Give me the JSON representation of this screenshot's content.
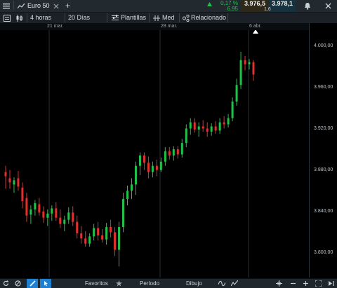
{
  "header": {
    "instrument": "Euro 50",
    "change_pct": "0,17 %",
    "change_abs": "6,95",
    "bid": "3.976,5",
    "ask": "3.978,1",
    "spread": "1,6",
    "add_tab": "+"
  },
  "toolbar": {
    "interval": "4 horas",
    "range": "20 Días",
    "templates": "Plantillas",
    "price_type": "Med",
    "related": "Relacionado"
  },
  "dates": [
    "21 mar.",
    "28 mar.",
    "6 abr."
  ],
  "price_axis": [
    "4.000,00",
    "3.960,00",
    "3.920,00",
    "3.880,00",
    "3.840,00",
    "3.800,00"
  ],
  "bottom": {
    "favorites": "Favoritos",
    "period": "Período",
    "drawing": "Dibujo"
  },
  "colors": {
    "up": "#21c24a",
    "down": "#e0312e",
    "background": "#000000"
  },
  "chart_data": {
    "type": "candlestick",
    "ylim": [
      3780,
      4020
    ],
    "candles": [
      {
        "o": 3878,
        "h": 3884,
        "l": 3862,
        "c": 3874
      },
      {
        "o": 3872,
        "h": 3880,
        "l": 3862,
        "c": 3868
      },
      {
        "o": 3866,
        "h": 3873,
        "l": 3858,
        "c": 3870
      },
      {
        "o": 3872,
        "h": 3879,
        "l": 3860,
        "c": 3864
      },
      {
        "o": 3863,
        "h": 3868,
        "l": 3843,
        "c": 3850
      },
      {
        "o": 3853,
        "h": 3858,
        "l": 3830,
        "c": 3836
      },
      {
        "o": 3837,
        "h": 3846,
        "l": 3828,
        "c": 3842
      },
      {
        "o": 3842,
        "h": 3851,
        "l": 3836,
        "c": 3848
      },
      {
        "o": 3847,
        "h": 3853,
        "l": 3836,
        "c": 3839
      },
      {
        "o": 3840,
        "h": 3845,
        "l": 3829,
        "c": 3834
      },
      {
        "o": 3834,
        "h": 3842,
        "l": 3826,
        "c": 3838
      },
      {
        "o": 3838,
        "h": 3846,
        "l": 3831,
        "c": 3843
      },
      {
        "o": 3843,
        "h": 3849,
        "l": 3831,
        "c": 3834
      },
      {
        "o": 3834,
        "h": 3842,
        "l": 3824,
        "c": 3828
      },
      {
        "o": 3828,
        "h": 3836,
        "l": 3821,
        "c": 3832
      },
      {
        "o": 3832,
        "h": 3844,
        "l": 3828,
        "c": 3839
      },
      {
        "o": 3839,
        "h": 3845,
        "l": 3826,
        "c": 3830
      },
      {
        "o": 3830,
        "h": 3836,
        "l": 3814,
        "c": 3819
      },
      {
        "o": 3819,
        "h": 3826,
        "l": 3809,
        "c": 3814
      },
      {
        "o": 3814,
        "h": 3821,
        "l": 3806,
        "c": 3809
      },
      {
        "o": 3809,
        "h": 3819,
        "l": 3806,
        "c": 3816
      },
      {
        "o": 3816,
        "h": 3828,
        "l": 3812,
        "c": 3824
      },
      {
        "o": 3824,
        "h": 3830,
        "l": 3812,
        "c": 3817
      },
      {
        "o": 3817,
        "h": 3823,
        "l": 3810,
        "c": 3813
      },
      {
        "o": 3813,
        "h": 3829,
        "l": 3808,
        "c": 3825
      },
      {
        "o": 3825,
        "h": 3832,
        "l": 3815,
        "c": 3820
      },
      {
        "o": 3820,
        "h": 3825,
        "l": 3797,
        "c": 3803
      },
      {
        "o": 3803,
        "h": 3830,
        "l": 3787,
        "c": 3825
      },
      {
        "o": 3825,
        "h": 3858,
        "l": 3820,
        "c": 3852
      },
      {
        "o": 3852,
        "h": 3865,
        "l": 3846,
        "c": 3860
      },
      {
        "o": 3860,
        "h": 3872,
        "l": 3852,
        "c": 3866
      },
      {
        "o": 3866,
        "h": 3888,
        "l": 3856,
        "c": 3884
      },
      {
        "o": 3884,
        "h": 3897,
        "l": 3875,
        "c": 3894
      },
      {
        "o": 3894,
        "h": 3897,
        "l": 3880,
        "c": 3887
      },
      {
        "o": 3887,
        "h": 3893,
        "l": 3872,
        "c": 3878
      },
      {
        "o": 3878,
        "h": 3888,
        "l": 3873,
        "c": 3884
      },
      {
        "o": 3884,
        "h": 3890,
        "l": 3874,
        "c": 3880
      },
      {
        "o": 3880,
        "h": 3892,
        "l": 3878,
        "c": 3888
      },
      {
        "o": 3888,
        "h": 3902,
        "l": 3884,
        "c": 3898
      },
      {
        "o": 3898,
        "h": 3902,
        "l": 3890,
        "c": 3894
      },
      {
        "o": 3894,
        "h": 3903,
        "l": 3889,
        "c": 3900
      },
      {
        "o": 3900,
        "h": 3903,
        "l": 3891,
        "c": 3895
      },
      {
        "o": 3895,
        "h": 3910,
        "l": 3892,
        "c": 3906
      },
      {
        "o": 3906,
        "h": 3924,
        "l": 3902,
        "c": 3920
      },
      {
        "o": 3920,
        "h": 3930,
        "l": 3914,
        "c": 3926
      },
      {
        "o": 3926,
        "h": 3930,
        "l": 3916,
        "c": 3919
      },
      {
        "o": 3919,
        "h": 3926,
        "l": 3912,
        "c": 3922
      },
      {
        "o": 3922,
        "h": 3928,
        "l": 3917,
        "c": 3920
      },
      {
        "o": 3920,
        "h": 3926,
        "l": 3912,
        "c": 3917
      },
      {
        "o": 3917,
        "h": 3925,
        "l": 3913,
        "c": 3922
      },
      {
        "o": 3922,
        "h": 3927,
        "l": 3915,
        "c": 3918
      },
      {
        "o": 3918,
        "h": 3930,
        "l": 3915,
        "c": 3926
      },
      {
        "o": 3926,
        "h": 3932,
        "l": 3920,
        "c": 3924
      },
      {
        "o": 3924,
        "h": 3934,
        "l": 3921,
        "c": 3930
      },
      {
        "o": 3930,
        "h": 3950,
        "l": 3927,
        "c": 3946
      },
      {
        "o": 3946,
        "h": 3968,
        "l": 3942,
        "c": 3962
      },
      {
        "o": 3962,
        "h": 3994,
        "l": 3958,
        "c": 3986
      },
      {
        "o": 3986,
        "h": 3990,
        "l": 3976,
        "c": 3982
      },
      {
        "o": 3982,
        "h": 3987,
        "l": 3977,
        "c": 3984
      },
      {
        "o": 3984,
        "h": 3986,
        "l": 3966,
        "c": 3972
      }
    ]
  }
}
